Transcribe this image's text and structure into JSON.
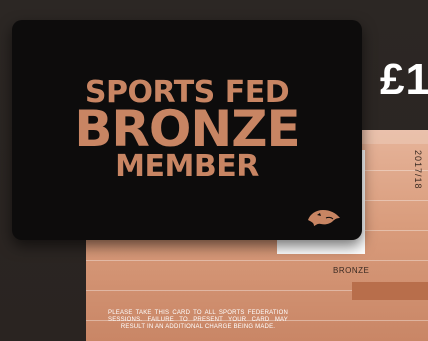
{
  "price_text": "£1",
  "front_card": {
    "line1": "SPORTS FED",
    "line2": "BRONZE",
    "line3": "MEMBER",
    "logo_icon": "panther-head-icon",
    "text_color": "#c88563",
    "background": "#0d0c0c"
  },
  "back_card": {
    "year": "2017/18",
    "tier_label": "BRONZE",
    "notice": "PLEASE TAKE THIS CARD TO ALL SPORTS FEDERATION SESSIONS. FAILURE TO PRESENT YOUR CARD MAY RESULT IN AN ADDITIONAL CHARGE BEING MADE.",
    "background": "#d99c7c"
  }
}
